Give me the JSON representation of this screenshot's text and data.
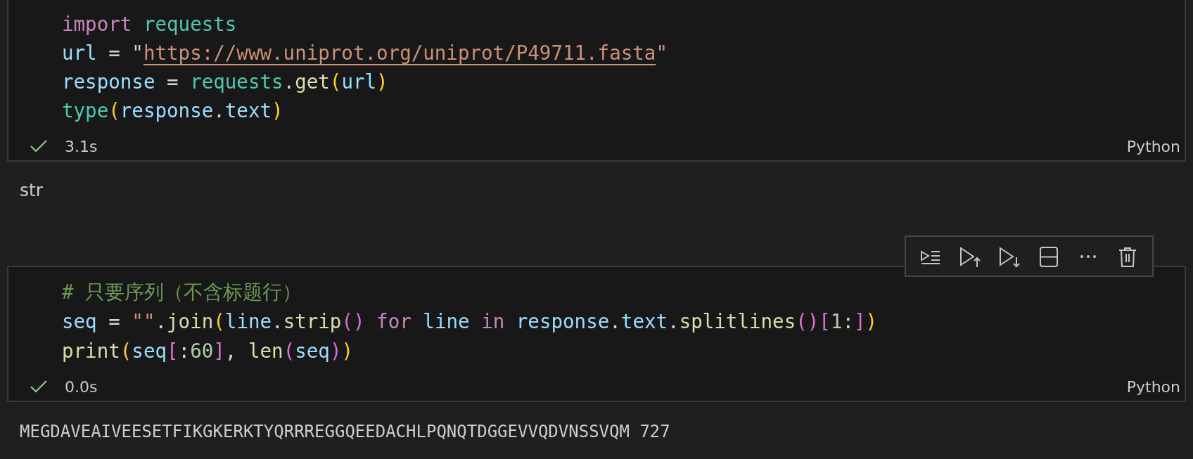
{
  "cells": [
    {
      "code": [
        {
          "tokens": [
            {
              "text": "import ",
              "kind": "keyword"
            },
            {
              "text": "requests",
              "kind": "type"
            }
          ]
        },
        {
          "tokens": [
            {
              "text": "url",
              "kind": "var"
            },
            {
              "text": " = \"",
              "kind": "plain"
            },
            {
              "text": "https://www.uniprot.org/uniprot/P49711.fasta",
              "kind": "link"
            },
            {
              "text": "\"",
              "kind": "string"
            }
          ]
        },
        {
          "tokens": [
            {
              "text": "response",
              "kind": "var"
            },
            {
              "text": " = ",
              "kind": "plain"
            },
            {
              "text": "requests",
              "kind": "type"
            },
            {
              "text": ".",
              "kind": "plain"
            },
            {
              "text": "get",
              "kind": "func"
            },
            {
              "text": "(",
              "kind": "bracket1"
            },
            {
              "text": "url",
              "kind": "var"
            },
            {
              "text": ")",
              "kind": "bracket1"
            }
          ]
        },
        {
          "tokens": [
            {
              "text": "type",
              "kind": "type"
            },
            {
              "text": "(",
              "kind": "bracket1"
            },
            {
              "text": "response",
              "kind": "var"
            },
            {
              "text": ".",
              "kind": "plain"
            },
            {
              "text": "text",
              "kind": "var"
            },
            {
              "text": ")",
              "kind": "bracket1"
            }
          ]
        }
      ],
      "status": {
        "success": true,
        "duration": "3.1s"
      },
      "language": "Python",
      "output": {
        "text": "str",
        "kind": "text"
      },
      "toolbar": false
    },
    {
      "code": [
        {
          "tokens": [
            {
              "text": "# 只要序列（不含标题行）",
              "kind": "comment"
            }
          ]
        },
        {
          "tokens": [
            {
              "text": "seq",
              "kind": "var"
            },
            {
              "text": " = ",
              "kind": "plain"
            },
            {
              "text": "\"\"",
              "kind": "string"
            },
            {
              "text": ".",
              "kind": "plain"
            },
            {
              "text": "join",
              "kind": "func"
            },
            {
              "text": "(",
              "kind": "bracket1"
            },
            {
              "text": "line",
              "kind": "var"
            },
            {
              "text": ".",
              "kind": "plain"
            },
            {
              "text": "strip",
              "kind": "func"
            },
            {
              "text": "()",
              "kind": "bracket2"
            },
            {
              "text": " for ",
              "kind": "keyword"
            },
            {
              "text": "line ",
              "kind": "var"
            },
            {
              "text": "in ",
              "kind": "keyword"
            },
            {
              "text": "response",
              "kind": "var"
            },
            {
              "text": ".",
              "kind": "plain"
            },
            {
              "text": "text",
              "kind": "var"
            },
            {
              "text": ".",
              "kind": "plain"
            },
            {
              "text": "splitlines",
              "kind": "func"
            },
            {
              "text": "()",
              "kind": "bracket2"
            },
            {
              "text": "[",
              "kind": "bracket2"
            },
            {
              "text": "1",
              "kind": "number"
            },
            {
              "text": ":",
              "kind": "plain"
            },
            {
              "text": "]",
              "kind": "bracket2"
            },
            {
              "text": ")",
              "kind": "bracket1"
            }
          ]
        },
        {
          "tokens": [
            {
              "text": "print",
              "kind": "func"
            },
            {
              "text": "(",
              "kind": "bracket1"
            },
            {
              "text": "seq",
              "kind": "var"
            },
            {
              "text": "[",
              "kind": "bracket2"
            },
            {
              "text": ":",
              "kind": "plain"
            },
            {
              "text": "60",
              "kind": "number"
            },
            {
              "text": "]",
              "kind": "bracket2"
            },
            {
              "text": ", ",
              "kind": "plain"
            },
            {
              "text": "len",
              "kind": "func"
            },
            {
              "text": "(",
              "kind": "bracket2"
            },
            {
              "text": "seq",
              "kind": "var"
            },
            {
              "text": ")",
              "kind": "bracket2"
            },
            {
              "text": ")",
              "kind": "bracket1"
            }
          ]
        }
      ],
      "status": {
        "success": true,
        "duration": "0.0s"
      },
      "language": "Python",
      "output": {
        "text": "MEGDAVEAIVEESETFIKGKERKTYQRRREGGQEEDACHLPQNQTDGGEVVQDVNSSVQM 727",
        "kind": "mono"
      },
      "toolbar": true
    }
  ]
}
